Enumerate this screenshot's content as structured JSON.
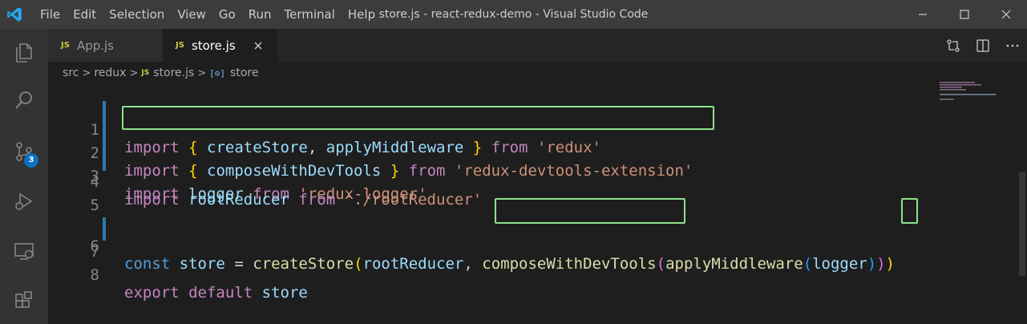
{
  "window": {
    "title": "store.js - react-redux-demo - Visual Studio Code"
  },
  "menu": {
    "items": [
      "File",
      "Edit",
      "Selection",
      "View",
      "Go",
      "Run",
      "Terminal",
      "Help"
    ]
  },
  "activity_bar": {
    "items": [
      "files-icon",
      "search-icon",
      "source-control-icon",
      "run-debug-icon",
      "remote-explorer-icon",
      "extensions-icon"
    ],
    "source_control_badge": "3"
  },
  "tabs": [
    {
      "icon_label": "JS",
      "label": "App.js",
      "active": false
    },
    {
      "icon_label": "JS",
      "label": "store.js",
      "active": true
    }
  ],
  "breadcrumbs": {
    "items": [
      "src",
      "redux"
    ],
    "file_icon": "JS",
    "file": "store.js",
    "symbol_icon": "[⊙]",
    "symbol": "store"
  },
  "editor": {
    "line_numbers": [
      "1",
      "2",
      "3",
      "4",
      "5",
      "6",
      "7",
      "8"
    ],
    "lines": [
      "import { createStore, applyMiddleware } from 'redux'",
      "import { composeWithDevTools } from 'redux-devtools-extension'",
      "import logger from 'redux-logger'",
      "import rootReducer from './rootReducer'",
      "",
      "const store = createStore(rootReducer, composeWithDevTools(applyMiddleware(logger)))",
      "",
      "export default store"
    ],
    "tokens": {
      "import": "import",
      "from": "from",
      "const": "const",
      "export": "export",
      "default": "default",
      "store": "store",
      "createStore": "createStore",
      "applyMiddleware": "applyMiddleware",
      "composeWithDevTools": "composeWithDevTools",
      "logger": "logger",
      "rootReducer": "rootReducer",
      "redux": "'redux'",
      "devtools_ext": "'redux-devtools-extension'",
      "redux_logger": "'redux-logger'",
      "root_path": "'./rootReducer'",
      "lbrace": "{",
      "rbrace": "}",
      "comma": ",",
      "eq": "=",
      "lparen": "(",
      "rparen": ")"
    }
  },
  "colors": {
    "highlight_box": "#8be38b",
    "accent": "#007acc"
  }
}
